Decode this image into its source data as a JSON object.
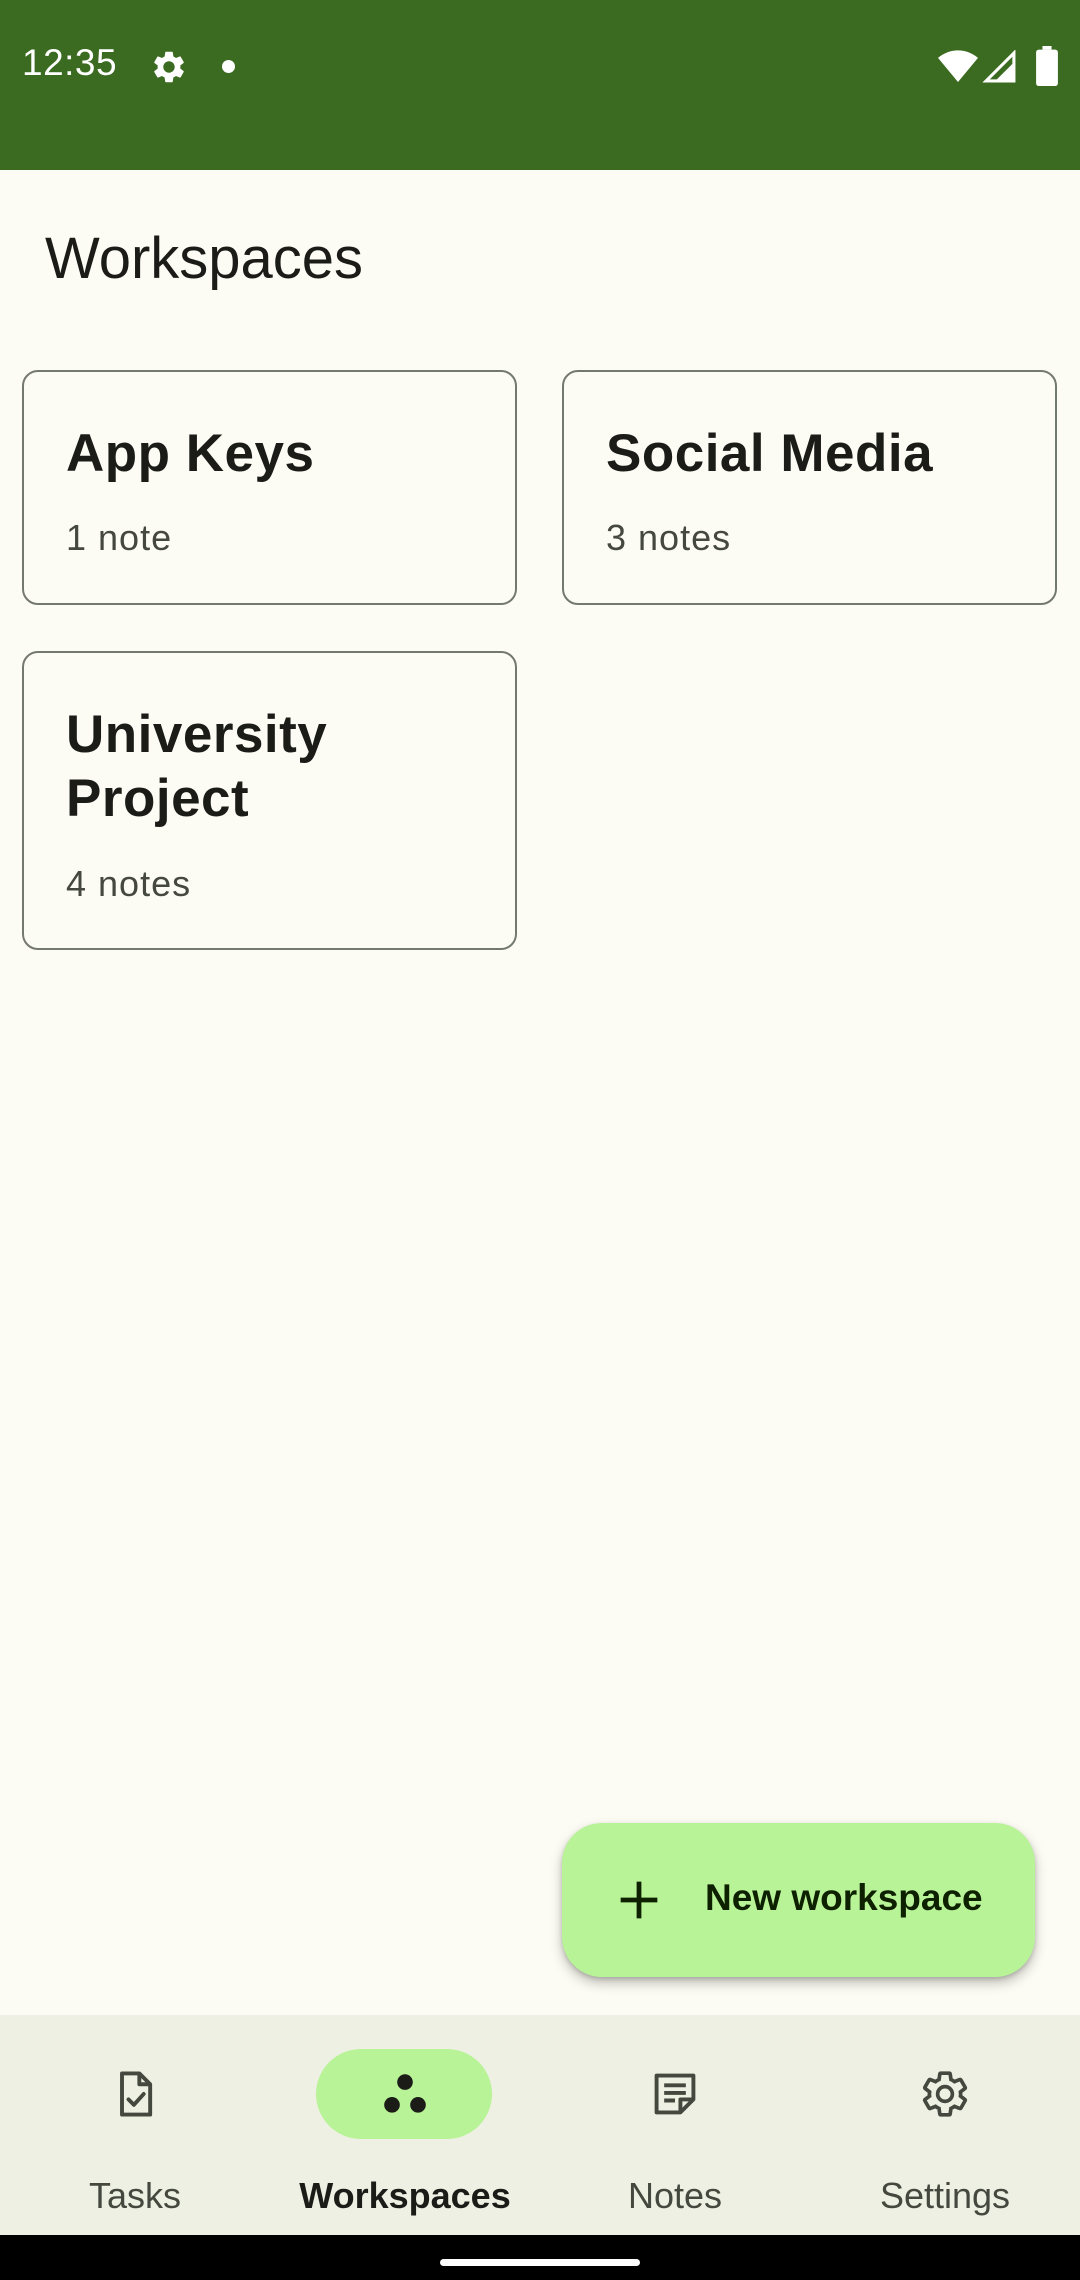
{
  "status_bar": {
    "time": "12:35",
    "icons": [
      "gear-icon",
      "notification-dot-icon",
      "wifi-icon",
      "signal-icon",
      "battery-icon"
    ],
    "background": "#3a6b20"
  },
  "page": {
    "title": "Workspaces"
  },
  "workspaces": [
    {
      "name": "App Keys",
      "count": "1 note"
    },
    {
      "name": "Social Media",
      "count": "3 notes"
    },
    {
      "name": "University Project",
      "count": "4 notes"
    }
  ],
  "fab": {
    "label": "New workspace",
    "icon": "plus-icon",
    "color": "#b8f397"
  },
  "bottom_nav": {
    "items": [
      {
        "label": "Tasks",
        "icon": "task-file-icon",
        "active": false
      },
      {
        "label": "Workspaces",
        "icon": "workspaces-icon",
        "active": true
      },
      {
        "label": "Notes",
        "icon": "notes-icon",
        "active": false
      },
      {
        "label": "Settings",
        "icon": "gear-icon",
        "active": false
      }
    ],
    "accent": "#b8f397"
  }
}
